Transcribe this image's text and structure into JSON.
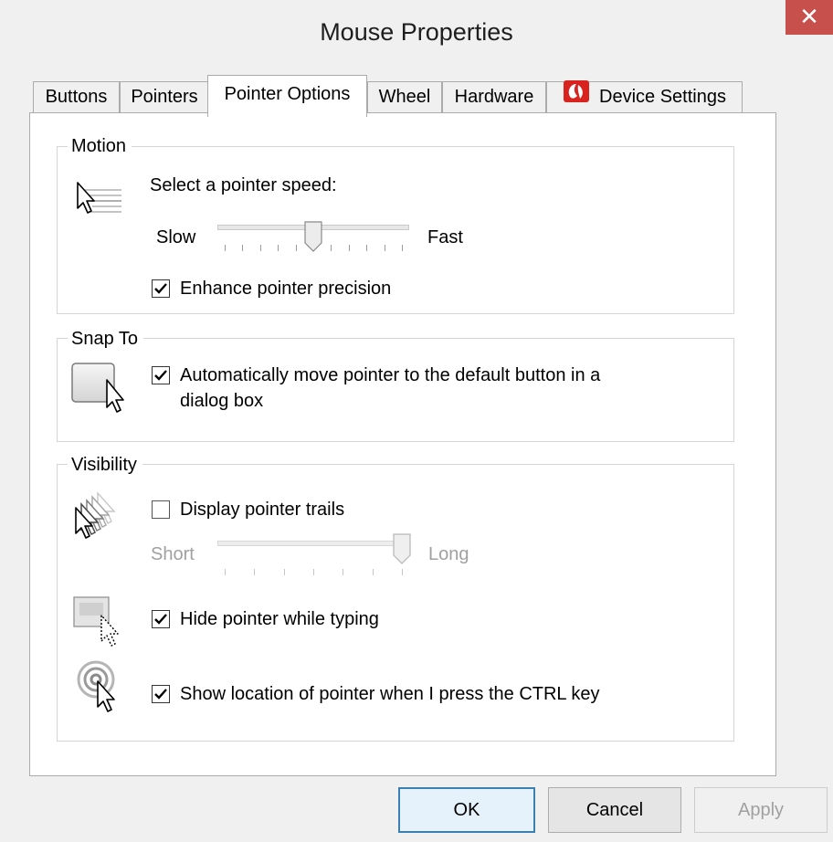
{
  "window": {
    "title": "Mouse Properties",
    "close_glyph": "✕"
  },
  "tabs": [
    {
      "label": "Buttons"
    },
    {
      "label": "Pointers"
    },
    {
      "label": "Pointer Options",
      "active": true
    },
    {
      "label": "Wheel"
    },
    {
      "label": "Hardware"
    },
    {
      "label": "Device Settings",
      "icon": "synaptics-icon"
    }
  ],
  "motion": {
    "group_label": "Motion",
    "speed_label": "Select a pointer speed:",
    "slow_label": "Slow",
    "fast_label": "Fast",
    "speed_value": 0.5,
    "speed_steps": 10,
    "precision_label": "Enhance pointer precision",
    "precision_checked": true
  },
  "snap_to": {
    "group_label": "Snap To",
    "line1": "Automatically move pointer to the default button in a",
    "line2": "dialog box",
    "checked": true
  },
  "visibility": {
    "group_label": "Visibility",
    "trails_label": "Display pointer trails",
    "trails_checked": false,
    "short_label": "Short",
    "long_label": "Long",
    "trail_length": 1.0,
    "hide_label": "Hide pointer while typing",
    "hide_checked": true,
    "ctrl_label": "Show location of pointer when I press the CTRL key",
    "ctrl_checked": true
  },
  "buttons": {
    "ok": "OK",
    "cancel": "Cancel",
    "apply": "Apply"
  },
  "colors": {
    "close": "#c7504c",
    "accent": "#3c7fb1"
  }
}
